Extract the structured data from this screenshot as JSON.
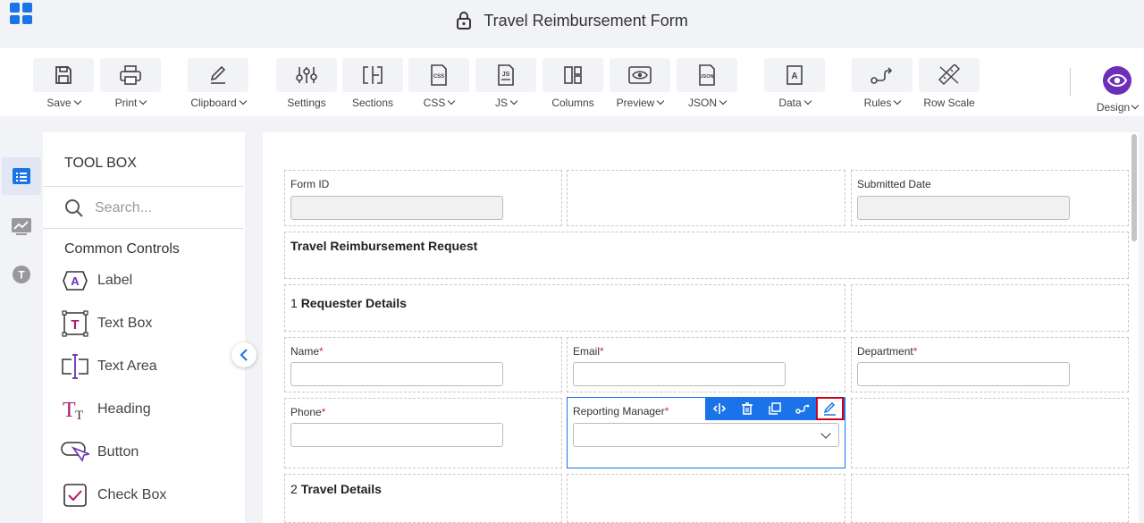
{
  "header": {
    "title": "Travel Reimbursement Form"
  },
  "toolbar": {
    "items": [
      {
        "label": "Save",
        "icon": "save-icon",
        "dropdown": true
      },
      {
        "label": "Print",
        "icon": "printer-icon",
        "dropdown": true
      },
      {
        "label": "Clipboard",
        "icon": "pencil-icon",
        "dropdown": true
      },
      {
        "label": "Settings",
        "icon": "sliders-icon",
        "dropdown": false
      },
      {
        "label": "Sections",
        "icon": "sections-icon",
        "dropdown": false
      },
      {
        "label": "CSS",
        "icon": "css-file-icon",
        "dropdown": true
      },
      {
        "label": "JS",
        "icon": "js-file-icon",
        "dropdown": true
      },
      {
        "label": "Columns",
        "icon": "columns-icon",
        "dropdown": false
      },
      {
        "label": "Preview",
        "icon": "preview-eye-icon",
        "dropdown": true
      },
      {
        "label": "JSON",
        "icon": "json-file-icon",
        "dropdown": true
      },
      {
        "label": "Data",
        "icon": "data-icon",
        "dropdown": true
      },
      {
        "label": "Rules",
        "icon": "rules-icon",
        "dropdown": true
      },
      {
        "label": "Row Scale",
        "icon": "row-scale-icon",
        "dropdown": false
      }
    ],
    "design_label": "Design"
  },
  "toolbox": {
    "title": "TOOL BOX",
    "search_placeholder": "Search...",
    "section": "Common Controls",
    "controls": [
      {
        "label": "Label",
        "icon": "label-icon"
      },
      {
        "label": "Text Box",
        "icon": "text-box-icon"
      },
      {
        "label": "Text Area",
        "icon": "text-area-icon"
      },
      {
        "label": "Heading",
        "icon": "heading-icon"
      },
      {
        "label": "Button",
        "icon": "button-icon"
      },
      {
        "label": "Check Box",
        "icon": "check-box-icon"
      }
    ]
  },
  "form": {
    "form_id_label": "Form ID",
    "submitted_date_label": "Submitted Date",
    "request_title": "Travel Reimbursement Request",
    "requester_number": "1",
    "requester_title": "Requester Details",
    "name_label": "Name",
    "email_label": "Email",
    "department_label": "Department",
    "phone_label": "Phone",
    "manager_label": "Reporting Manager",
    "required_mark": "*",
    "travel_number": "2",
    "travel_title": "Travel Details"
  },
  "colors": {
    "accent": "#1a73e8",
    "design": "#6b2fb8",
    "required": "#d32f2f",
    "highlight": "#d0021b"
  }
}
